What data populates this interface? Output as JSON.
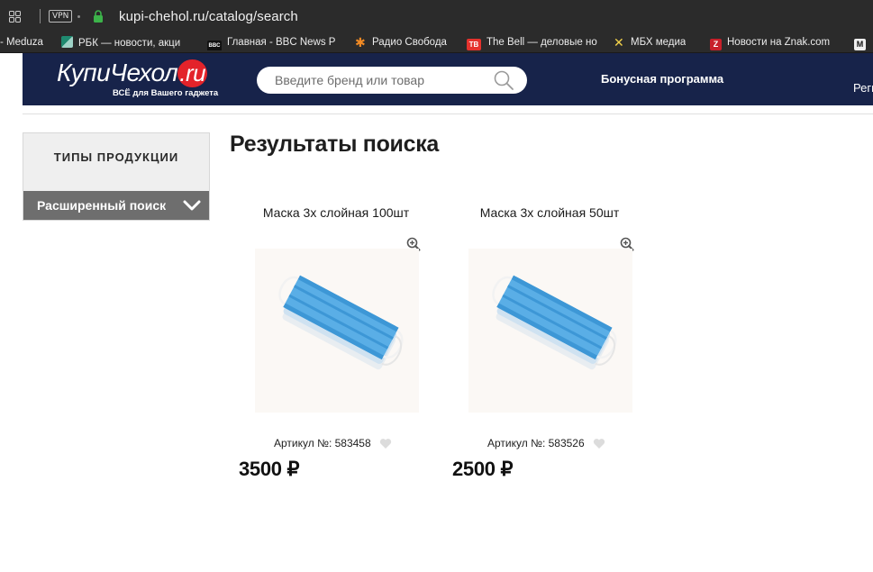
{
  "browser": {
    "vpn_label": "VPN",
    "url": "kupi-chehol.ru/catalog/search",
    "bookmarks": [
      {
        "label": "- Meduza",
        "icon": "meduza-icon"
      },
      {
        "label": "РБК — новости, акци",
        "icon": "rbc-icon"
      },
      {
        "label": "Главная - BBC News Р",
        "icon": "bbc-icon"
      },
      {
        "label": "Радио Свобода",
        "icon": "svoboda-icon"
      },
      {
        "label": "The Bell — деловые но",
        "icon": "thebell-icon"
      },
      {
        "label": "МБХ медиа",
        "icon": "mbh-icon"
      },
      {
        "label": "Новости на Znak.com",
        "icon": "znak-icon"
      }
    ],
    "bookmark_fav_text": {
      "bbc": "BBC",
      "thebell": "TB",
      "znak": "Z",
      "m": "M"
    }
  },
  "header": {
    "logo_text": "КупиЧехол",
    "logo_domain": ".ru",
    "logo_tagline": "ВСЁ для Вашего гаджета",
    "search_placeholder": "Введите бренд или товар",
    "bonus": "Бонусная программа",
    "register": "Регис"
  },
  "sidebar": {
    "product_types": "ТИПЫ ПРОДУКЦИИ",
    "advanced_search": "Расширенный поиск"
  },
  "main": {
    "title": "Результаты поиска",
    "products": [
      {
        "name": "Маска 3х слойная 100шт",
        "article": "Артикул №: 583458",
        "price": "3500 ₽"
      },
      {
        "name": "Маска 3х слойная 50шт",
        "article": "Артикул №: 583526",
        "price": "2500 ₽"
      }
    ]
  },
  "colors": {
    "header_bg": "#17234a",
    "logo_accent": "#e3232a",
    "sidebar_adv_bg": "#6e6e6e",
    "mask_blue": "#4fa3e0"
  }
}
